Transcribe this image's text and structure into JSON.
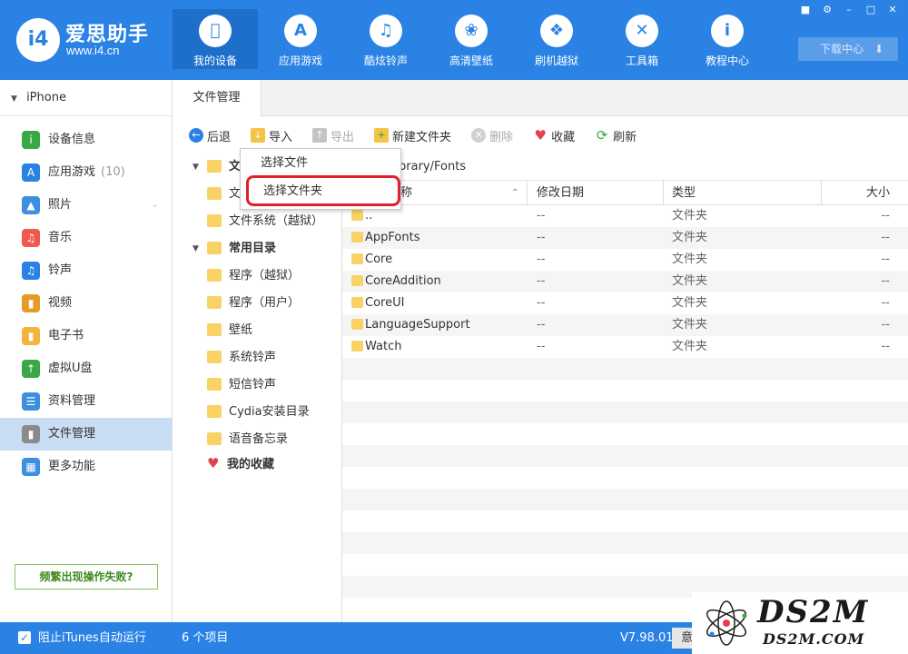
{
  "app": {
    "logo_mark": "i4",
    "name": "爱思助手",
    "url": "www.i4.cn"
  },
  "nav": [
    {
      "label": "我的设备",
      "icon": "apple-icon"
    },
    {
      "label": "应用游戏",
      "icon": "app-store-icon"
    },
    {
      "label": "酷炫铃声",
      "icon": "bell-icon"
    },
    {
      "label": "高清壁纸",
      "icon": "flower-icon"
    },
    {
      "label": "刷机越狱",
      "icon": "box-icon"
    },
    {
      "label": "工具箱",
      "icon": "tools-icon"
    },
    {
      "label": "教程中心",
      "icon": "info-icon"
    }
  ],
  "download_center": "下载中心",
  "device": "iPhone",
  "sidebar": [
    {
      "label": "设备信息",
      "icon": "info-icon",
      "color": "#3aa845"
    },
    {
      "label": "应用游戏",
      "count": "(10)",
      "icon": "app-store-icon",
      "color": "#2a82e4"
    },
    {
      "label": "照片",
      "icon": "photo-icon",
      "color": "#3d8fe0"
    },
    {
      "label": "音乐",
      "icon": "music-icon",
      "color": "#f0594e"
    },
    {
      "label": "铃声",
      "icon": "bell-icon",
      "color": "#2a82e4"
    },
    {
      "label": "视频",
      "icon": "film-icon",
      "color": "#e59a2a"
    },
    {
      "label": "电子书",
      "icon": "book-icon",
      "color": "#f2b43a"
    },
    {
      "label": "虚拟U盘",
      "icon": "usb-icon",
      "color": "#3aa845"
    },
    {
      "label": "资料管理",
      "icon": "contacts-icon",
      "color": "#3d8fe0"
    },
    {
      "label": "文件管理",
      "icon": "file-icon",
      "color": "#8a8a8a"
    },
    {
      "label": "更多功能",
      "icon": "grid-icon",
      "color": "#3d8fe0"
    }
  ],
  "help_button": "频繁出现操作失败?",
  "tab": "文件管理",
  "toolbar": {
    "back": "后退",
    "import": "导入",
    "export": "导出",
    "new_folder": "新建文件夹",
    "delete": "删除",
    "favorite": "收藏",
    "refresh": "刷新"
  },
  "tree": {
    "group1_label": "文",
    "group1_item1": "文",
    "group1_item2": "文件系统（越狱）",
    "group2_label": "常用目录",
    "items": [
      "程序（越狱）",
      "程序（用户）",
      "壁纸",
      "系统铃声",
      "短信铃声",
      "Cydia安装目录",
      "语音备忘录"
    ],
    "favorites": "我的收藏"
  },
  "dropdown": {
    "item1": "选择文件",
    "item2": "选择文件夹"
  },
  "path": "brary/Fonts",
  "columns": {
    "name": "称",
    "date": "修改日期",
    "type": "类型",
    "size": "大小"
  },
  "rows": [
    {
      "name": "..",
      "date": "--",
      "type": "文件夹",
      "size": "--"
    },
    {
      "name": "AppFonts",
      "date": "--",
      "type": "文件夹",
      "size": "--"
    },
    {
      "name": "Core",
      "date": "--",
      "type": "文件夹",
      "size": "--"
    },
    {
      "name": "CoreAddition",
      "date": "--",
      "type": "文件夹",
      "size": "--"
    },
    {
      "name": "CoreUI",
      "date": "--",
      "type": "文件夹",
      "size": "--"
    },
    {
      "name": "LanguageSupport",
      "date": "--",
      "type": "文件夹",
      "size": "--"
    },
    {
      "name": "Watch",
      "date": "--",
      "type": "文件夹",
      "size": "--"
    }
  ],
  "status": {
    "itunes": "阻止iTunes自动运行",
    "count": "6 个项目",
    "version": "V7.98.01",
    "button": "意"
  },
  "watermark": {
    "big": "DS2M",
    "small": "DS2M.COM"
  }
}
